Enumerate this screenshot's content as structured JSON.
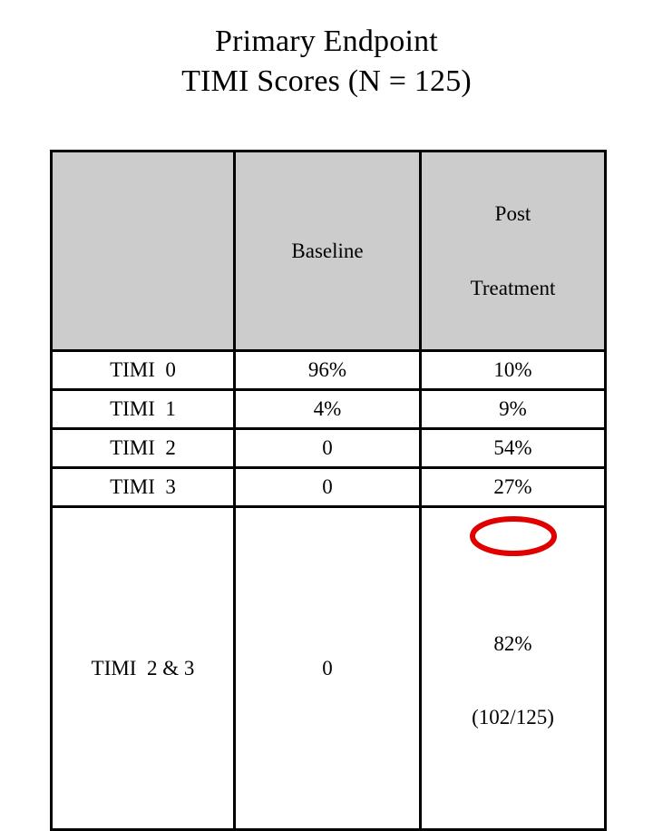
{
  "slide": {
    "title_lines": [
      "Primary Endpoint",
      "TIMI Scores (N = 125)"
    ]
  },
  "table": {
    "columns": {
      "row_label_header": "",
      "baseline_header": "Baseline",
      "post_header_line1": "Post",
      "post_header_line2": "Treatment"
    },
    "rows": [
      {
        "label": "TIMI  0",
        "baseline": "96%",
        "post": "10%"
      },
      {
        "label": "TIMI  1",
        "baseline": "4%",
        "post": "9%"
      },
      {
        "label": "TIMI  2",
        "baseline": "0",
        "post": "54%"
      },
      {
        "label": "TIMI  3",
        "baseline": "0",
        "post": "27%"
      }
    ],
    "total_row": {
      "label": "TIMI  2 & 3",
      "baseline": "0",
      "post_main": "82%",
      "post_sub": "(102/125)"
    }
  },
  "annotation": {
    "shape": "red-ellipse-highlight",
    "target_value": "82%",
    "color": "#e00000"
  },
  "colors": {
    "header_fill": "#cccccc",
    "border": "#000000",
    "text": "#000000",
    "background": "#ffffff"
  }
}
